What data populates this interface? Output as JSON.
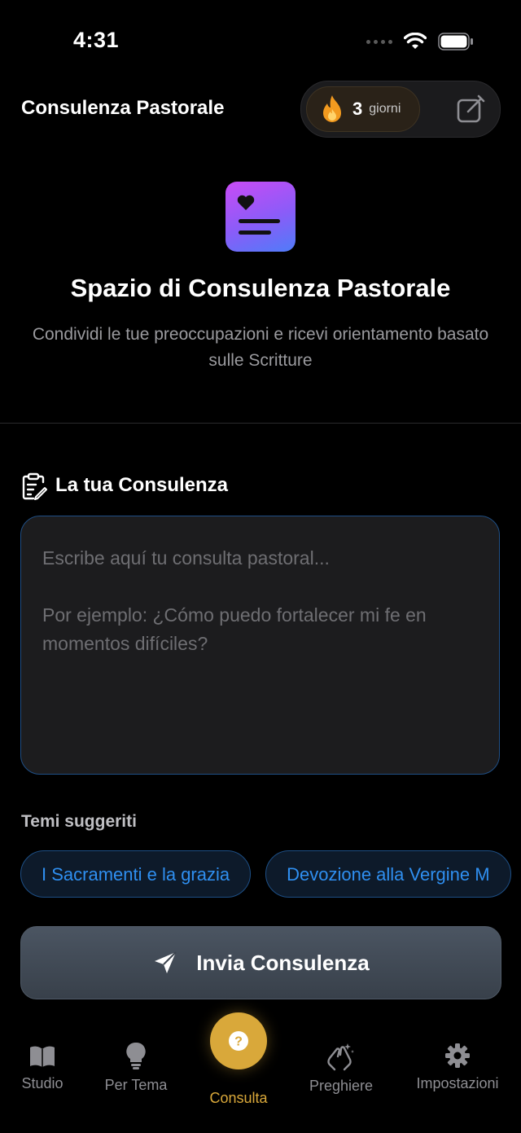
{
  "status_bar": {
    "time": "4:31"
  },
  "header": {
    "title": "Consulenza Pastorale",
    "streak_count": "3",
    "streak_unit": "giorni",
    "streak_icon": "flame-icon",
    "edit_icon": "compose-icon"
  },
  "hero": {
    "title": "Spazio di Consulenza Pastorale",
    "subtitle": "Condividi le tue preoccupazioni e ricevi orientamento basato sulle Scritture",
    "icon": "heart-document-icon"
  },
  "consultation": {
    "section_title": "La tua Consulenza",
    "section_icon": "clipboard-edit-icon",
    "placeholder": "Escribe aquí tu consulta pastoral...\n\nPor ejemplo: ¿Cómo puedo fortalecer mi fe en momentos difíciles?"
  },
  "suggestions": {
    "label": "Temi suggeriti",
    "items": [
      "I Sacramenti e la grazia",
      "Devozione alla Vergine M"
    ]
  },
  "send_button": {
    "label": "Invia Consulenza",
    "icon": "paper-plane-icon"
  },
  "tabs": [
    {
      "label": "Studio",
      "icon": "book-icon"
    },
    {
      "label": "Per Tema",
      "icon": "lightbulb-icon"
    },
    {
      "label": "Consulta",
      "icon": "question-icon",
      "active": true
    },
    {
      "label": "Preghiere",
      "icon": "praying-hands-icon"
    },
    {
      "label": "Impostazioni",
      "icon": "gear-icon"
    }
  ],
  "colors": {
    "accent_blue": "#2f8ff0",
    "accent_gold": "#d9a83a",
    "background": "#000000"
  }
}
